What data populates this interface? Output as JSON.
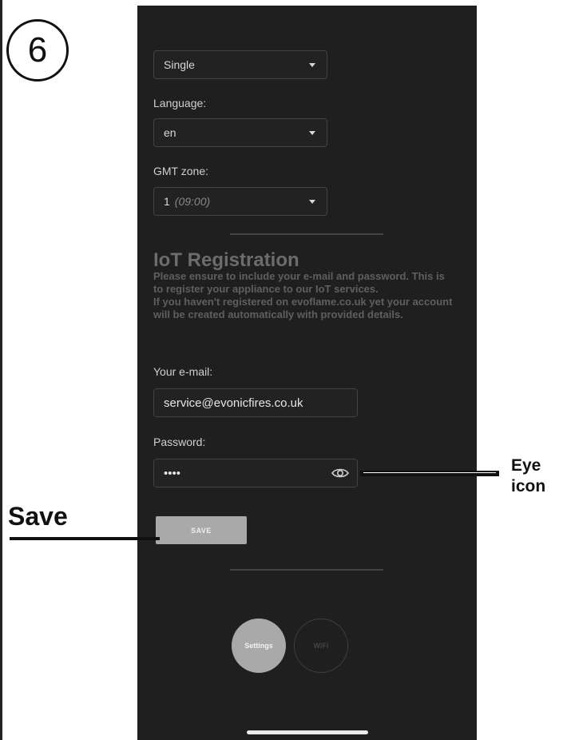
{
  "step": {
    "number": "6"
  },
  "settings": {
    "mode": {
      "value": "Single"
    },
    "language": {
      "label": "Language:",
      "value": "en"
    },
    "gmt": {
      "label": "GMT zone:",
      "value": "1",
      "time": "(09:00)"
    }
  },
  "iot": {
    "title": "IoT Registration",
    "description": [
      "Please ensure to include your e-mail and password. This is to register your appliance to our IoT services.",
      "If you haven't registered on evoflame.co.uk yet your account will be created automatically with provided details."
    ],
    "email": {
      "label": "Your e-mail:",
      "value": "service@evonicfires.co.uk"
    },
    "password": {
      "label": "Password:",
      "value": "••••"
    },
    "save_label": "SAVE"
  },
  "nav": {
    "settings_label": "Settings",
    "wifi_label": "WiFi"
  },
  "annotations": {
    "save": "Save",
    "eye_line1": "Eye",
    "eye_line2": "icon"
  },
  "icons": {
    "eye": "eye-icon",
    "dropdown": "chevron-down-icon"
  },
  "colors": {
    "background": "#1f1f1f",
    "button": "#a9a9a9"
  }
}
